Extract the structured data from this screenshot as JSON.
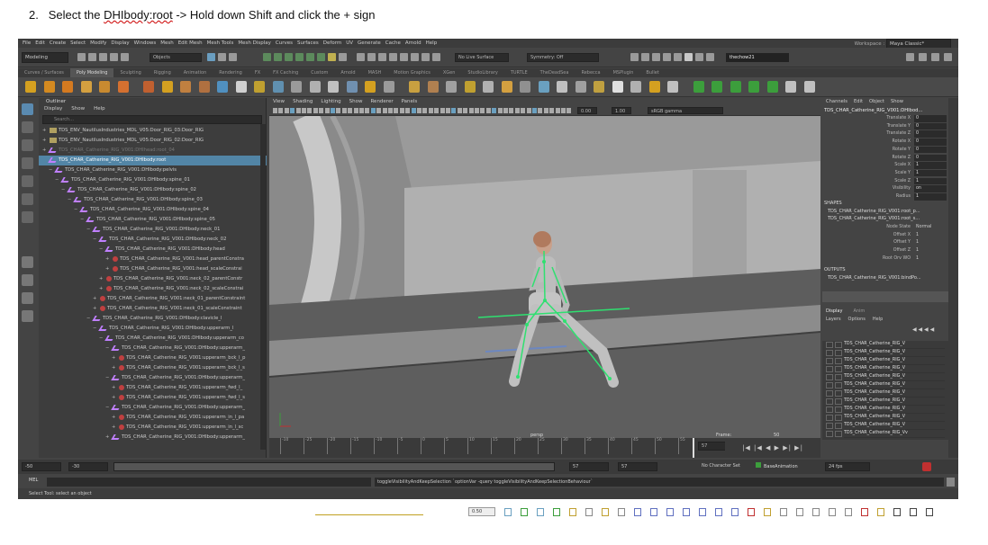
{
  "instruction": {
    "number": "2.",
    "prefix": "Select the ",
    "squiggle": "DHIbody:root",
    "suffix": " -> Hold down Shift and click the + sign"
  },
  "menubar": [
    "File",
    "Edit",
    "Create",
    "Select",
    "Modify",
    "Display",
    "Windows",
    "Mesh",
    "Edit Mesh",
    "Mesh Tools",
    "Mesh Display",
    "Curves",
    "Surfaces",
    "Deform",
    "UV",
    "Generate",
    "Cache",
    "Arnold",
    "Help"
  ],
  "workspace": {
    "label": "Workspace :",
    "value": "Maya Classic*"
  },
  "statusline": {
    "mode": "Modeling",
    "objects": "Objects",
    "live_surface": "No Live Surface",
    "symmetry": "Symmetry: Off",
    "user": "thechow21"
  },
  "shelf_tabs": [
    "Curves / Surfaces",
    "Poly Modeling",
    "Sculpting",
    "Rigging",
    "Animation",
    "Rendering",
    "FX",
    "FX Caching",
    "Custom",
    "Arnold",
    "MASH",
    "Motion Graphics",
    "XGen",
    "StudioLibrary",
    "TURTLE",
    "TheDeadSea",
    "Rebecca",
    "MSPlugin",
    "Bullet"
  ],
  "outliner": {
    "title": "Outliner",
    "menu": [
      "Display",
      "Show",
      "Help"
    ],
    "search_placeholder": "Search...",
    "rows": [
      {
        "text": "TDS_ENV_NautilusIndustries_MDL_V05:Door_RIG_03:Door_RIG",
        "depth": 0,
        "exp": "+",
        "icon": "grp"
      },
      {
        "text": "TDS_ENV_NautilusIndustries_MDL_V05:Door_RIG_02:Door_RIG",
        "depth": 0,
        "exp": "+",
        "icon": "grp"
      },
      {
        "text": "TDS_CHAR_Catherine_RIG_V001:DHIhead:root_04",
        "depth": 0,
        "exp": "+",
        "icon": "joint",
        "dim": true
      },
      {
        "text": "TDS_CHAR_Catherine_RIG_V001:DHIbody:root",
        "depth": 0,
        "exp": "",
        "icon": "joint",
        "sel": true
      },
      {
        "text": "TDS_CHAR_Catherine_RIG_V001:DHIbody:pelvis",
        "depth": 1,
        "exp": "-",
        "icon": "joint"
      },
      {
        "text": "TDS_CHAR_Catherine_RIG_V001:DHIbody:spine_01",
        "depth": 2,
        "exp": "-",
        "icon": "joint"
      },
      {
        "text": "TDS_CHAR_Catherine_RIG_V001:DHIbody:spine_02",
        "depth": 3,
        "exp": "-",
        "icon": "joint"
      },
      {
        "text": "TDS_CHAR_Catherine_RIG_V001:DHIbody:spine_03",
        "depth": 4,
        "exp": "-",
        "icon": "joint"
      },
      {
        "text": "TDS_CHAR_Catherine_RIG_V001:DHIbody:spine_04",
        "depth": 5,
        "exp": "-",
        "icon": "joint"
      },
      {
        "text": "TDS_CHAR_Catherine_RIG_V001:DHIbody:spine_05",
        "depth": 6,
        "exp": "-",
        "icon": "joint"
      },
      {
        "text": "TDS_CHAR_Catherine_RIG_V001:DHIbody:neck_01",
        "depth": 7,
        "exp": "-",
        "icon": "joint"
      },
      {
        "text": "TDS_CHAR_Catherine_RIG_V001:DHIbody:neck_02",
        "depth": 8,
        "exp": "-",
        "icon": "joint"
      },
      {
        "text": "TDS_CHAR_Catherine_RIG_V001:DHIbody:head",
        "depth": 9,
        "exp": "-",
        "icon": "joint"
      },
      {
        "text": "TDS_CHAR_Catherine_RIG_V001:head_parentConstra",
        "depth": 10,
        "exp": "+",
        "icon": "con"
      },
      {
        "text": "TDS_CHAR_Catherine_RIG_V001:head_scaleConstrai",
        "depth": 10,
        "exp": "+",
        "icon": "con"
      },
      {
        "text": "TDS_CHAR_Catherine_RIG_V001:neck_02_parentConstr",
        "depth": 9,
        "exp": "+",
        "icon": "con"
      },
      {
        "text": "TDS_CHAR_Catherine_RIG_V001:neck_02_scaleConstrai",
        "depth": 9,
        "exp": "+",
        "icon": "con"
      },
      {
        "text": "TDS_CHAR_Catherine_RIG_V001:neck_01_parentConstraint",
        "depth": 8,
        "exp": "+",
        "icon": "con"
      },
      {
        "text": "TDS_CHAR_Catherine_RIG_V001:neck_01_scaleConstraint",
        "depth": 8,
        "exp": "+",
        "icon": "con"
      },
      {
        "text": "TDS_CHAR_Catherine_RIG_V001:DHIbody:clavicle_l",
        "depth": 7,
        "exp": "-",
        "icon": "joint"
      },
      {
        "text": "TDS_CHAR_Catherine_RIG_V001:DHIbody:upperarm_l",
        "depth": 8,
        "exp": "-",
        "icon": "joint"
      },
      {
        "text": "TDS_CHAR_Catherine_RIG_V001:DHIbody:upperarm_co",
        "depth": 9,
        "exp": "-",
        "icon": "joint"
      },
      {
        "text": "TDS_CHAR_Catherine_RIG_V001:DHIbody:upperarm_",
        "depth": 10,
        "exp": "-",
        "icon": "joint"
      },
      {
        "text": "TDS_CHAR_Catherine_RIG_V001:upperarm_bck_l_p",
        "depth": 11,
        "exp": "+",
        "icon": "con"
      },
      {
        "text": "TDS_CHAR_Catherine_RIG_V001:upperarm_bck_l_s",
        "depth": 11,
        "exp": "+",
        "icon": "con"
      },
      {
        "text": "TDS_CHAR_Catherine_RIG_V001:DHIbody:upperarm_",
        "depth": 10,
        "exp": "-",
        "icon": "joint"
      },
      {
        "text": "TDS_CHAR_Catherine_RIG_V001:upperarm_fwd_l_",
        "depth": 11,
        "exp": "+",
        "icon": "con"
      },
      {
        "text": "TDS_CHAR_Catherine_RIG_V001:upperarm_fwd_l_s",
        "depth": 11,
        "exp": "+",
        "icon": "con"
      },
      {
        "text": "TDS_CHAR_Catherine_RIG_V001:DHIbody:upperarm_",
        "depth": 10,
        "exp": "-",
        "icon": "joint"
      },
      {
        "text": "TDS_CHAR_Catherine_RIG_V001:upperarm_in_l_pa",
        "depth": 11,
        "exp": "+",
        "icon": "con"
      },
      {
        "text": "TDS_CHAR_Catherine_RIG_V001:upperarm_in_l_sc",
        "depth": 11,
        "exp": "+",
        "icon": "con"
      },
      {
        "text": "TDS_CHAR_Catherine_RIG_V001:DHIbody:upperarm_",
        "depth": 10,
        "exp": "+",
        "icon": "joint"
      }
    ]
  },
  "viewport": {
    "menu": [
      "View",
      "Shading",
      "Lighting",
      "Show",
      "Renderer",
      "Panels"
    ],
    "exposure": "0.00",
    "gamma": "1.00",
    "colorspace": "sRGB gamma",
    "camera_label": "persp",
    "frame_label": "Frame:",
    "fps_label": "50"
  },
  "channelbox": {
    "menu": [
      "Channels",
      "Edit",
      "Object",
      "Show"
    ],
    "title": "TDS_CHAR_Catherine_RIG_V001:DHIbod...",
    "attrs": [
      {
        "name": "Translate X",
        "value": "0"
      },
      {
        "name": "Translate Y",
        "value": "0"
      },
      {
        "name": "Translate Z",
        "value": "0"
      },
      {
        "name": "Rotate X",
        "value": "0"
      },
      {
        "name": "Rotate Y",
        "value": "0"
      },
      {
        "name": "Rotate Z",
        "value": "0"
      },
      {
        "name": "Scale X",
        "value": "1"
      },
      {
        "name": "Scale Y",
        "value": "1"
      },
      {
        "name": "Scale Z",
        "value": "1"
      },
      {
        "name": "Visibility",
        "value": "on"
      },
      {
        "name": "Radius",
        "value": "1"
      }
    ],
    "shapes_label": "SHAPES",
    "shape1": "TDS_CHAR_Catherine_RIG_V001:root_p...",
    "shape2": "TDS_CHAR_Catherine_RIG_V001:root_s...",
    "shape_attrs": [
      {
        "name": "Node State",
        "value": "Normal"
      },
      {
        "name": "Offset X",
        "value": "1"
      },
      {
        "name": "Offset Y",
        "value": "1"
      },
      {
        "name": "Offset Z",
        "value": "1"
      },
      {
        "name": "Root Orv WO",
        "value": "1"
      }
    ],
    "outputs_label": "OUTPUTS",
    "output1": "TDS_CHAR_Catherine_RIG_V001:bindPo...",
    "layer_tabs": [
      "Display",
      "Anim"
    ],
    "layer_menu": [
      "Layers",
      "Options",
      "Help"
    ],
    "layers": [
      "TDS_CHAR_Catherine_RIG_V",
      "TDS_CHAR_Catherine_RIG_V",
      "TDS_CHAR_Catherine_RIG_V",
      "TDS_CHAR_Catherine_RIG_V",
      "TDS_CHAR_Catherine_RIG_V",
      "TDS_CHAR_Catherine_RIG_V",
      "TDS_CHAR_Catherine_RIG_V",
      "TDS_CHAR_Catherine_RIG_V",
      "TDS_CHAR_Catherine_RIG_V",
      "TDS_CHAR_Catherine_RIG_V",
      "TDS_CHAR_Catherine_RIG_V",
      "TDS_CHAR_Catherine_RIG_Vv"
    ]
  },
  "timeslider": {
    "ticks": [
      "-10",
      "-25",
      "-20",
      "-15",
      "-10",
      "-5",
      "0",
      "5",
      "10",
      "15",
      "20",
      "25",
      "30",
      "35",
      "40",
      "45",
      "50",
      "55"
    ],
    "current": "57"
  },
  "range": {
    "start": "-50",
    "start2": "-30",
    "end1": "57",
    "end2": "57",
    "end3": "57",
    "char_set": "No Character Set",
    "anim_layer": "BaseAnimation",
    "fps": "24 fps"
  },
  "mel": {
    "label": "MEL",
    "command": "toggleVisibilityAndKeepSelection `optionVar -query toggleVisibilityAndKeepSelectionBehaviour`"
  },
  "helpline": "Select Tool: select an object",
  "taskbar_value": "0.50"
}
